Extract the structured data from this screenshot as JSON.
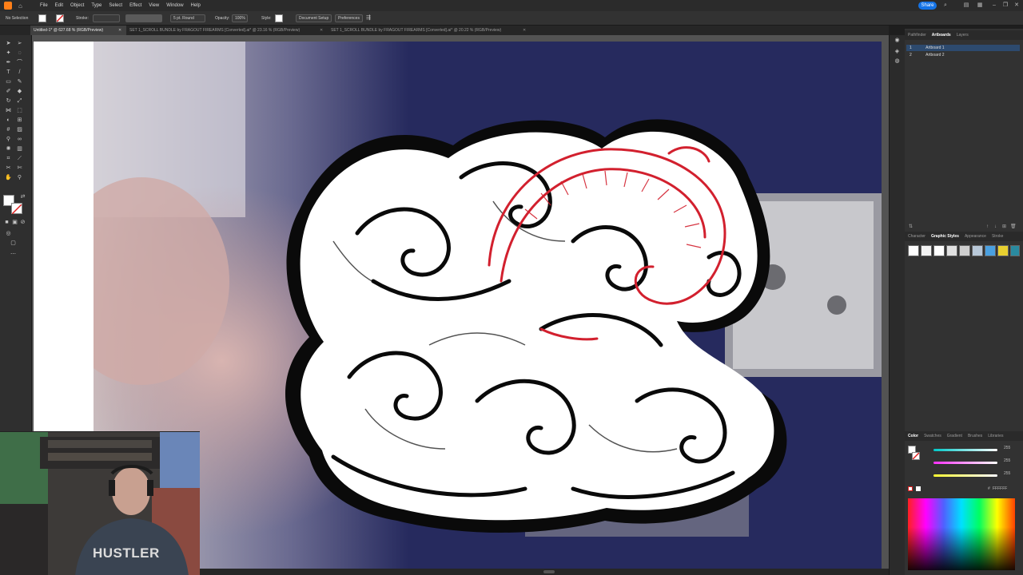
{
  "app": {
    "logo_icon": "illustrator-logo-icon",
    "menus": [
      "File",
      "Edit",
      "Object",
      "Type",
      "Select",
      "Effect",
      "View",
      "Window",
      "Help"
    ],
    "share_label": "Share",
    "accent": "#1473e6"
  },
  "control": {
    "selection": "No Selection",
    "stroke_label": "Stroke:",
    "brush": "5 pt. Round",
    "opacity_label": "Opacity:",
    "opacity_value": "100%",
    "style_label": "Style:",
    "doc_setup": "Document Setup",
    "preferences": "Preferences"
  },
  "tabs": [
    {
      "label": "Untitled-1* @ 627.68 % (RGB/Preview)",
      "active": true
    },
    {
      "label": "SET 1_SCROLL BUNDLE by FRAGOUT FIREARMS [Converted].ai* @ 23.16 % (RGB/Preview)",
      "active": false
    },
    {
      "label": "SET 1_SCROLL BUNDLE by FRAGOUT FIREARMS [Converted].ai* @ 20.22 % (RGB/Preview)",
      "active": false
    }
  ],
  "panels": {
    "top_tabs": [
      "Pathfinder",
      "Artboards",
      "Layers"
    ],
    "artboards": [
      {
        "num": "1",
        "name": "Artboard 1",
        "selected": true
      },
      {
        "num": "2",
        "name": "Artboard 2",
        "selected": false
      }
    ],
    "mid_tabs": [
      "Character",
      "Graphic Styles",
      "Appearance",
      "Stroke"
    ],
    "color_tabs": [
      "Color",
      "Swatches",
      "Gradient",
      "Brushes",
      "Libraries"
    ],
    "color_values": [
      "255",
      "255",
      "255"
    ],
    "hex_value": "FFFFFF"
  },
  "webcam": {
    "shirt_text": "HUSTLER"
  }
}
